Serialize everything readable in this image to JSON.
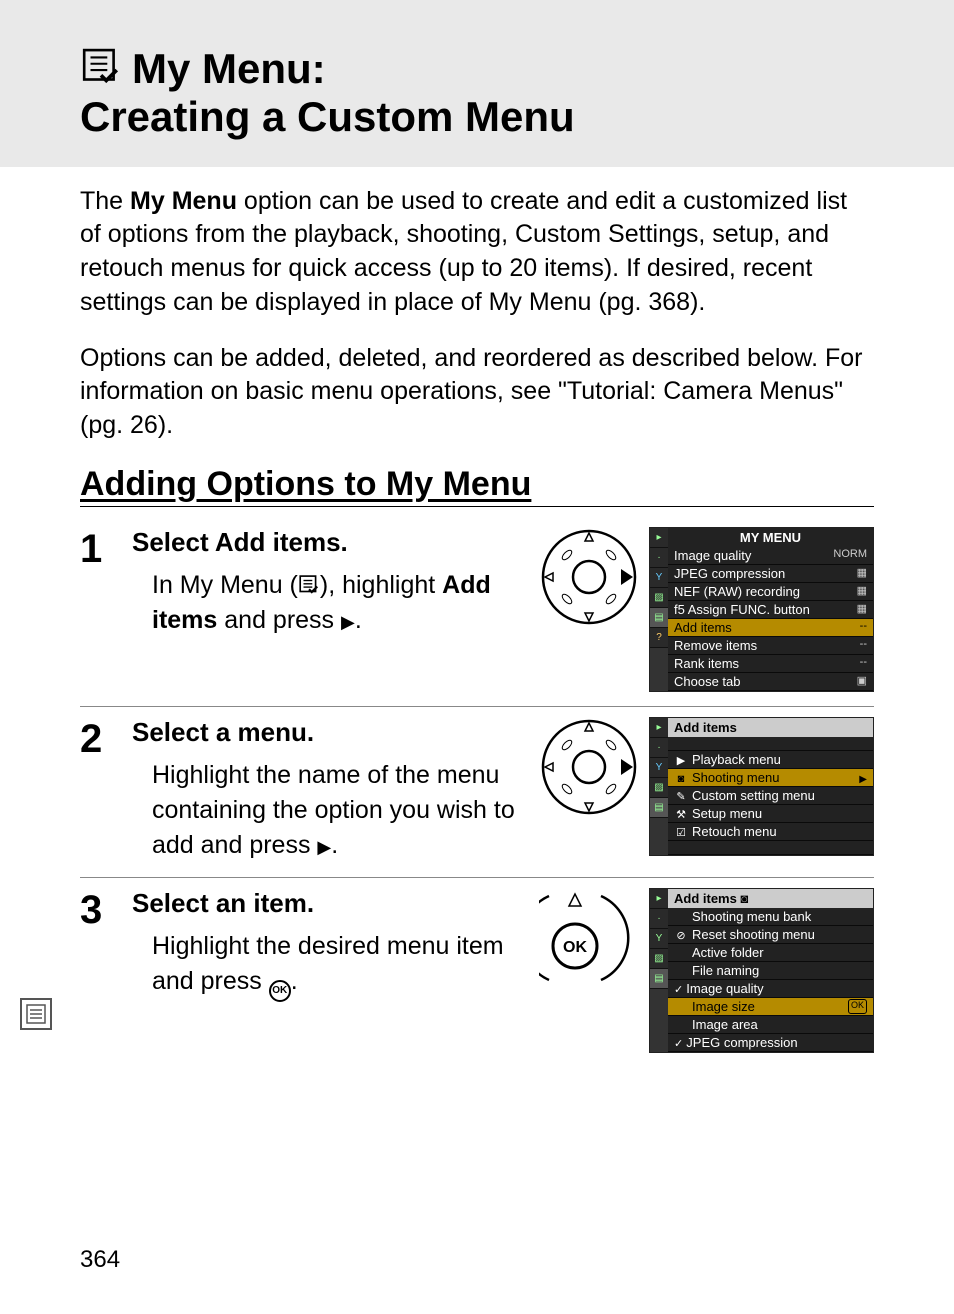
{
  "header": {
    "title_line1": "My Menu:",
    "title_line2": "Creating a Custom Menu"
  },
  "intro": {
    "p1_pre": "The ",
    "p1_bold": "My Menu",
    "p1_post": " option can be used to create and edit a customized list of options from the playback, shooting, Custom Settings, setup, and retouch menus for quick access (up to 20 items).  If desired, recent settings can be displayed in place of My Menu (pg. 368).",
    "p2": "Options can be added, deleted, and reordered as described below. For information on basic menu operations, see \"Tutorial: Camera Menus\" (pg. 26)."
  },
  "section_heading": "Adding Options to My Menu",
  "steps": [
    {
      "num": "1",
      "heading": "Select Add items.",
      "body_pre": "In My Menu (",
      "body_mid": "), highlight ",
      "body_bold": "Add items",
      "body_post": " and press ",
      "screen": {
        "title": "MY MENU",
        "rows": [
          {
            "label": "Image quality",
            "val": "NORM"
          },
          {
            "label": "JPEG compression",
            "val": "▦"
          },
          {
            "label": "NEF (RAW) recording",
            "val": "▦"
          },
          {
            "label": "f5 Assign FUNC. button",
            "val": "▦"
          },
          {
            "label": "Add items",
            "val": "--",
            "hl": true
          },
          {
            "label": "Remove items",
            "val": "--"
          },
          {
            "label": "Rank items",
            "val": "--"
          },
          {
            "label": "Choose tab",
            "val": "▣"
          }
        ]
      }
    },
    {
      "num": "2",
      "heading": "Select a menu.",
      "body": "Highlight the name of the menu containing the option you wish to add and press ",
      "screen": {
        "title": "Add items",
        "rows": [
          {
            "icon": "▶",
            "label": "Playback menu"
          },
          {
            "icon": "◙",
            "label": "Shooting menu",
            "hl": true,
            "arrow": true
          },
          {
            "icon": "✎",
            "label": "Custom setting menu"
          },
          {
            "icon": "⚒",
            "label": "Setup menu"
          },
          {
            "icon": "☑",
            "label": "Retouch menu"
          }
        ]
      }
    },
    {
      "num": "3",
      "heading": "Select an item.",
      "body": "Highlight the desired menu item and press ",
      "screen": {
        "title": "Add items ◙",
        "rows": [
          {
            "label": "Shooting menu bank"
          },
          {
            "icon": "⊘",
            "label": "Reset shooting menu"
          },
          {
            "label": "Active folder"
          },
          {
            "label": "File naming"
          },
          {
            "chk": true,
            "label": "Image quality"
          },
          {
            "label": "Image size",
            "hl": true,
            "ok": true
          },
          {
            "label": "Image area"
          },
          {
            "chk": true,
            "label": "JPEG compression"
          }
        ]
      }
    }
  ],
  "page_number": "364"
}
